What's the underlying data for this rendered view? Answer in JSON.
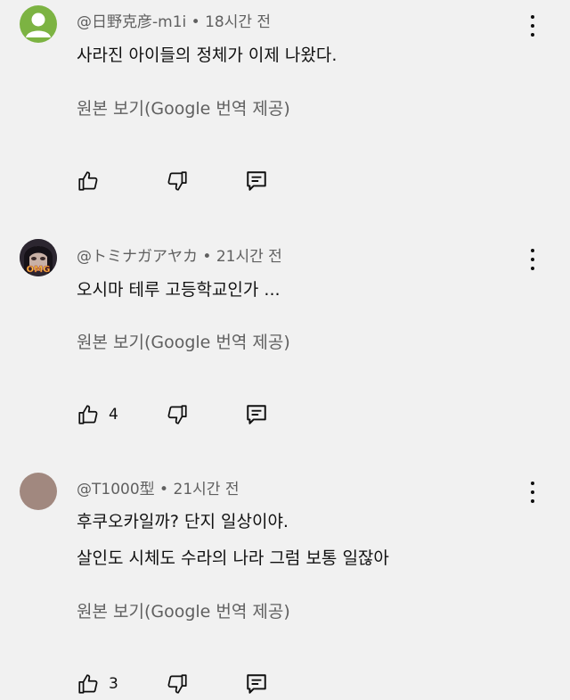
{
  "comments": [
    {
      "author": "@日野克彦-m1i",
      "sep": " • ",
      "time": "18시간 전",
      "lines": [
        "사라진 아이들의 정체가 이제 나왔다."
      ],
      "translate_label": "원본 보기(Google 번역 제공)",
      "likes": "",
      "avatar_color": "#7cb342"
    },
    {
      "author": "@トミナガアヤカ",
      "sep": " • ",
      "time": "21시간 전",
      "lines": [
        "오시마 테루  고등학교인가 ..."
      ],
      "translate_label": "원본 보기(Google 번역 제공)",
      "likes": "4",
      "avatar_badge": "OMG"
    },
    {
      "author": "@T1000型",
      "sep": " • ",
      "time": "21시간 전",
      "lines": [
        "후쿠오카일까? 단지 일상이야.",
        "살인도 시체도 수라의 나라 그럼 보통 일잖아"
      ],
      "translate_label": "원본 보기(Google 번역 제공)",
      "likes": "3",
      "avatar_color": "#a1887f"
    }
  ]
}
